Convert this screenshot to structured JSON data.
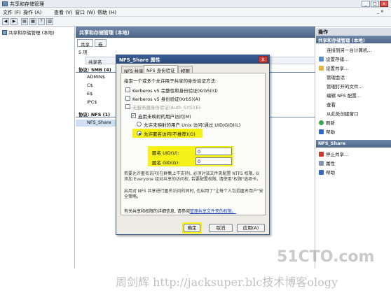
{
  "window": {
    "title": "共享和存储管理"
  },
  "menu": [
    "文件 (F)",
    "操作 (A)",
    "查看 (V)",
    "窗口 (W)",
    "帮助 (H)"
  ],
  "tree": {
    "root": "共享和存储管理 (本地)"
  },
  "center": {
    "header": "共享和存储管理 (本地)",
    "tabs": [
      "共享",
      "卷"
    ],
    "count": "5 项",
    "column_header": "共享名",
    "groups": [
      {
        "label": "协议: SMB (4)",
        "rows": [
          "ADMIN$",
          "C$",
          "E$",
          "IPC$"
        ]
      },
      {
        "label": "协议: NFS (1)",
        "rows": [
          "NFS_Share"
        ]
      }
    ]
  },
  "actions": {
    "header": "操作",
    "section1": "共享和存储管理 (本地)",
    "items1": [
      "连接到另一台计算机...",
      "设置存储...",
      "设置共享...",
      "管理会话",
      "管理打开的文件...",
      "编辑 NFS 配置...",
      "查看",
      "从此处创建窗口",
      "刷新",
      "帮助"
    ],
    "section2": "NFS_Share",
    "items2": [
      "停止共享...",
      "属性",
      "帮助"
    ]
  },
  "dialog": {
    "title": "NFS_Share 属性",
    "tabs": [
      "NFS 共享",
      "NFS 身份验证",
      "权限"
    ],
    "intro": "指定一个或多个允许用于共享的身份验证方法:",
    "methods": [
      "Kerberos v5 完整性和身份验证(Krb5i)(I)",
      "Kerberos v5 身份验证(Krb5)(A)",
      "无服务器身份验证(Auth_SYS)(E)"
    ],
    "unmapped_label": "启用未映射的用户访问(M)",
    "unix_option": "允许未映射的用户 Unix 访问(通过 UID/GID)(L)",
    "anon_option": "允许匿名访问(不推荐)(O)",
    "uid_label": "匿名 UID(U):",
    "uid_value": "0",
    "gid_label": "匿名 GID(G):",
    "gid_value": "0",
    "note1": "若要允许匿名访问(在群集上不支持), 必须对该文件夹配置 NTFS 权限, 以添加 Everyone 组对共享的访问权, 若要配置权限, 请使用\"权限\"选项卡。",
    "note2": "启用对 NFS 共享进行匿名访问的同时, 也启用了\"让每个人包括匿名用户\"安全策略。",
    "more_text": "有关共享和权限的详细信息, 请参阅",
    "more_link": "管理共享文件夹的权限。",
    "buttons": [
      "确定",
      "取消",
      "应用(A)"
    ]
  },
  "watermark": {
    "logo": "51CTO.com",
    "credit": "周剑辉 http://jacksuper.blc技术博客ology"
  },
  "colors": {
    "dialog_title": "#2a4677",
    "highlight": "#f6f118",
    "header": "#4d6688"
  }
}
